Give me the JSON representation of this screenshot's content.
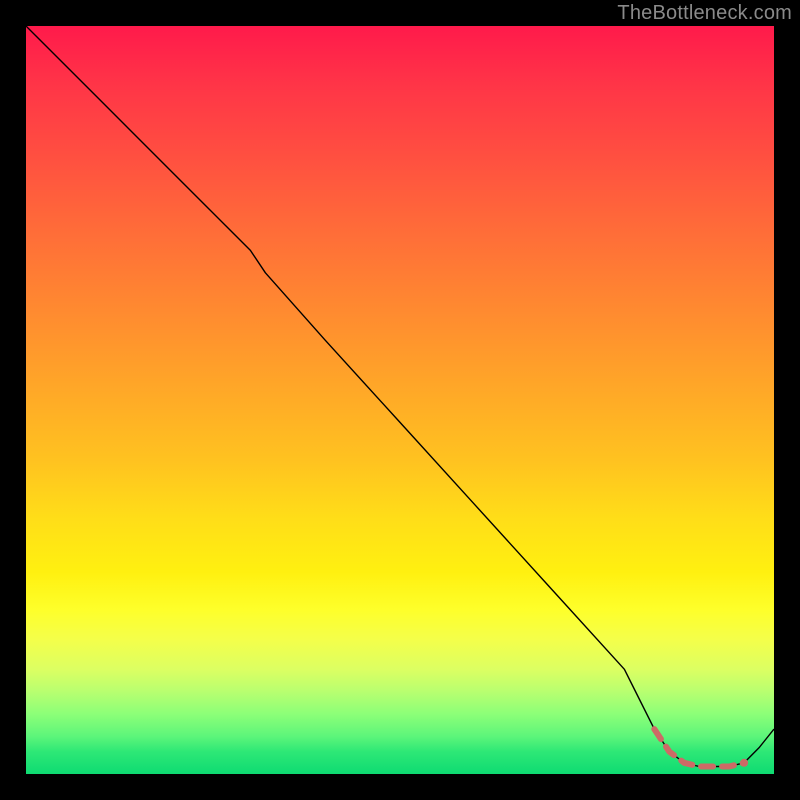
{
  "watermark": "TheBottleneck.com",
  "chart_data": {
    "type": "line",
    "title": "",
    "xlabel": "",
    "ylabel": "",
    "xlim": [
      0,
      100
    ],
    "ylim": [
      0,
      100
    ],
    "grid": false,
    "background_gradient": {
      "top_color": "#ff1a4b",
      "mid_color": "#ffe020",
      "bottom_color": "#0edb72"
    },
    "series": [
      {
        "name": "curve",
        "color": "#000000",
        "stroke_width": 1.4,
        "x": [
          0,
          10,
          20,
          30,
          32,
          40,
          50,
          60,
          70,
          80,
          84,
          86,
          88,
          90,
          92,
          94,
          96,
          98,
          100
        ],
        "values": [
          100,
          90,
          80,
          70,
          67,
          58,
          47,
          36,
          25,
          14,
          6,
          3,
          1.5,
          1,
          1,
          1,
          1.5,
          3.5,
          6
        ]
      },
      {
        "name": "highlight-segment",
        "color": "#cc6b66",
        "stroke_width": 6,
        "x": [
          84,
          86,
          88,
          90,
          92,
          94,
          96
        ],
        "values": [
          6,
          3,
          1.5,
          1,
          1,
          1,
          1.5
        ]
      }
    ],
    "markers": [
      {
        "name": "highlight-end-dot",
        "x": 96,
        "y": 1.5,
        "r": 4,
        "color": "#cc6b66"
      }
    ]
  }
}
